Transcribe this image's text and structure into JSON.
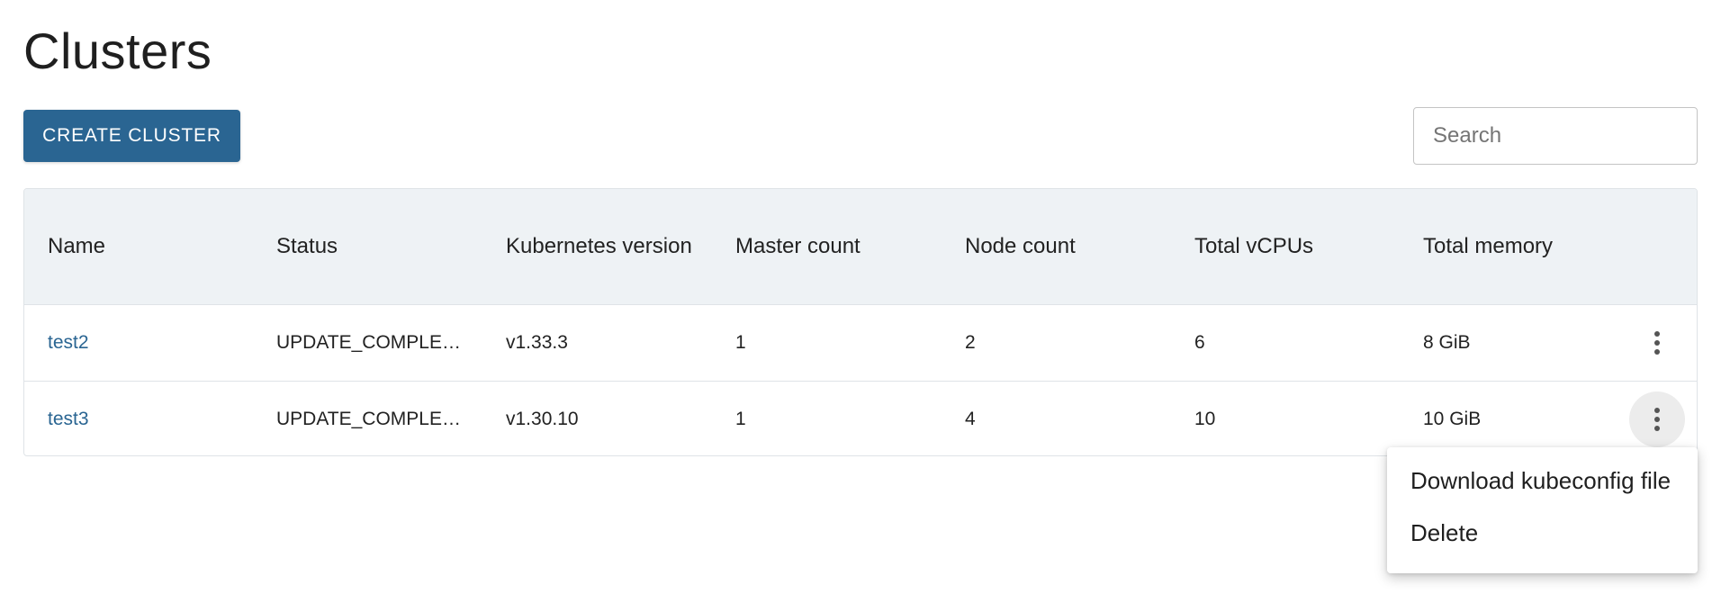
{
  "page": {
    "title": "Clusters"
  },
  "toolbar": {
    "create_label": "CREATE CLUSTER",
    "search_placeholder": "Search",
    "search_value": ""
  },
  "table": {
    "columns": [
      "Name",
      "Status",
      "Kubernetes version",
      "Master count",
      "Node count",
      "Total vCPUs",
      "Total memory"
    ],
    "rows": [
      {
        "name": "test2",
        "status": "UPDATE_COMPLE…",
        "version": "v1.33.3",
        "masters": "1",
        "nodes": "2",
        "vcpus": "6",
        "memory": "8 GiB"
      },
      {
        "name": "test3",
        "status": "UPDATE_COMPLE…",
        "version": "v1.30.10",
        "masters": "1",
        "nodes": "4",
        "vcpus": "10",
        "memory": "10 GiB"
      }
    ]
  },
  "row_menu": {
    "open_for_row": "test3",
    "items": [
      "Download kubeconfig file",
      "Delete"
    ]
  },
  "colors": {
    "accent": "#2a6592",
    "header_bg": "#eef2f5",
    "border": "#dfe3e7"
  },
  "icons": {
    "row_menu": "more-vert-icon"
  }
}
